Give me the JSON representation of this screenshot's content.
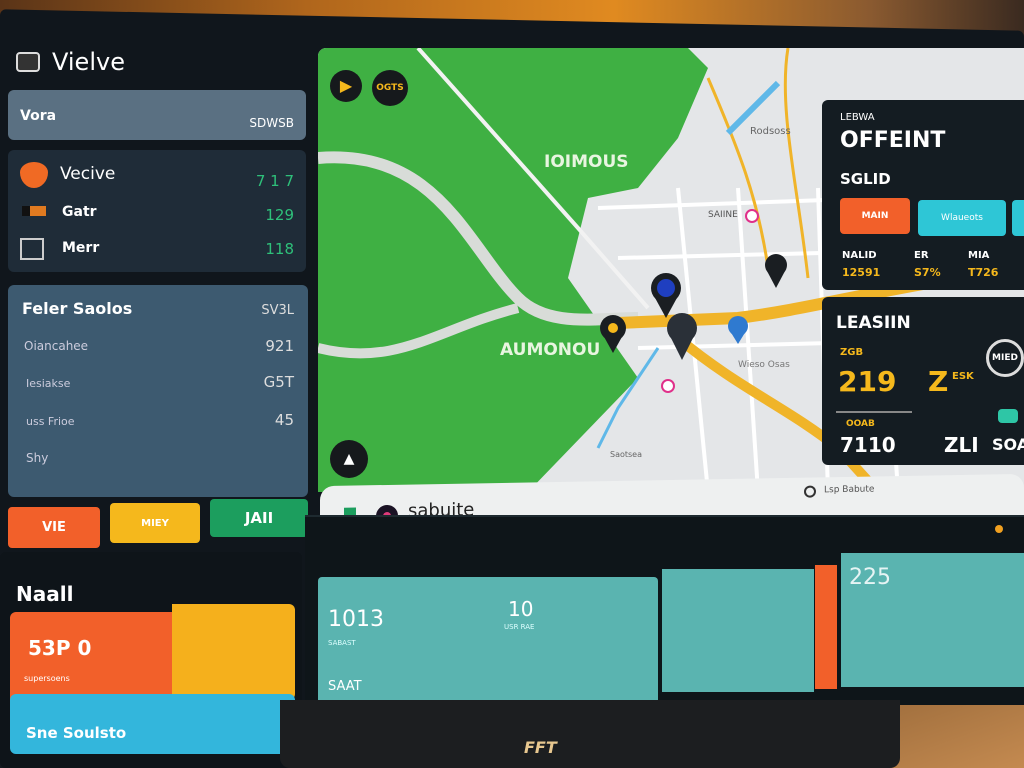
{
  "app": {
    "title": "Vielve"
  },
  "left": {
    "header_row": {
      "label": "Vora",
      "value": "SDWSB"
    },
    "vehicles": [
      {
        "icon": "shield-icon",
        "label": "Vecive",
        "value": "7 1 7"
      },
      {
        "icon": "car-icon",
        "label": "Gatr",
        "value": "129"
      },
      {
        "icon": "truck-icon",
        "label": "Merr",
        "value": "118"
      }
    ],
    "stats": {
      "title": "Feler Saolos",
      "title_value": "SV3L",
      "rows": [
        {
          "label": "Oiancahee",
          "value": "921"
        },
        {
          "label": "Iesiakse",
          "value": "G5T"
        },
        {
          "label": "uss Frioe",
          "value": "45"
        },
        {
          "label": "Shy",
          "value": ""
        }
      ]
    },
    "buttons": [
      "VIE",
      "MIEY",
      "JAII"
    ],
    "bottom": {
      "title": "Naall",
      "big_value": "53P 0",
      "sub": "supersoens",
      "bar_label": "Sne Soulsto"
    }
  },
  "map": {
    "play_button": "play-icon",
    "ogts_label": "OGTS",
    "labels": [
      "IOIMOUS",
      "AUMONOU",
      "Rodsoss",
      "SAIINE",
      "Wieso Osas",
      "Saotsea"
    ]
  },
  "search": {
    "value": "sabuite",
    "right_label": "Lsp Babute"
  },
  "right": {
    "card1": {
      "kicker": "LEBWA",
      "title": "OFFEINT",
      "sub": "SGLID",
      "buttons": [
        "MAIN",
        "Wlaueots"
      ],
      "cols": [
        {
          "label": "NALID",
          "value": "12591"
        },
        {
          "label": "ER",
          "value": "S7%"
        },
        {
          "label": "MIA",
          "value": "T726"
        }
      ]
    },
    "card2": {
      "title": "LEASIIN",
      "small": "ZGB",
      "big1": "219",
      "big2": "Z",
      "big2_sup": "ESK",
      "badge": "MIED",
      "tag": "OOAB",
      "val1": "7110",
      "val2": "ZLI",
      "val3": "SOA"
    }
  },
  "bottom_panel": {
    "tile1_value": "1013",
    "tile1_sub": "SABAST",
    "tile1_value2": "10",
    "tile1_sub2": "USR RAE",
    "tile1_foot": "SAAT",
    "tile3_value": "225"
  },
  "brand": "FFT",
  "colors": {
    "orange": "#f2602a",
    "yellow": "#f5b81c",
    "green": "#1c9e5e",
    "teal": "#5ab4b0",
    "map_green": "#3fb043",
    "cyan": "#2ec6d6"
  }
}
